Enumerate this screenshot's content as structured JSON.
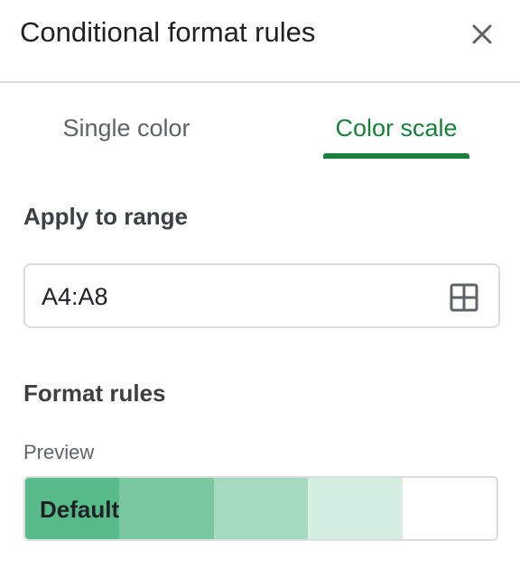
{
  "header": {
    "title": "Conditional format rules",
    "close_icon": "close-icon"
  },
  "tabs": [
    {
      "label": "Single color",
      "selected": false
    },
    {
      "label": "Color scale",
      "selected": true
    }
  ],
  "apply_range": {
    "label": "Apply to range",
    "value": "A4:A8",
    "icon": "grid-select-icon"
  },
  "format_rules": {
    "label": "Format rules",
    "preview_label": "Preview",
    "preview_text": "Default",
    "scale_colors": [
      "#57bb8a",
      "#79c89f",
      "#a4dbbf",
      "#d4eee1",
      "#ffffff"
    ]
  },
  "colors": {
    "accent": "#188038",
    "border": "#dadce0",
    "muted_text": "#5f6368"
  }
}
